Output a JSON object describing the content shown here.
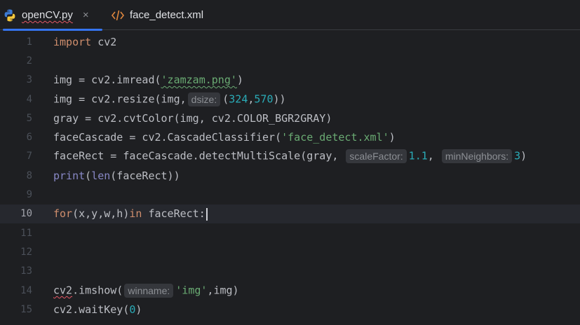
{
  "tabs": [
    {
      "label": "openCV.py",
      "active": true,
      "icon": "python-icon",
      "close": "×"
    },
    {
      "label": "face_detect.xml",
      "active": false,
      "icon": "xml-icon"
    }
  ],
  "hints": {
    "dsize": "dsize:",
    "scaleFactor": "scaleFactor:",
    "minNeighbors": "minNeighbors:",
    "winname": "winname:"
  },
  "lines": [
    {
      "n": "1",
      "tokens": [
        "import",
        " cv2"
      ]
    },
    {
      "n": "2"
    },
    {
      "n": "3",
      "tokens": [
        "img = cv2.imread(",
        "'zamzam.png'",
        ")"
      ]
    },
    {
      "n": "4",
      "tokens": [
        "img = cv2.resize(img,",
        "(",
        "324",
        ",",
        "570",
        "))"
      ]
    },
    {
      "n": "5",
      "tokens": [
        "gray = cv2.cvtColor(img, cv2.COLOR_BGR2GRAY)"
      ]
    },
    {
      "n": "6",
      "tokens": [
        "faceCascade = cv2.CascadeClassifier(",
        "'face_detect.xml'",
        ")"
      ]
    },
    {
      "n": "7",
      "tokens": [
        "faceRect = faceCascade.detectMultiScale(gray, ",
        "1.1",
        ", ",
        "3",
        ")"
      ]
    },
    {
      "n": "8",
      "tokens": [
        "print",
        "(",
        "len",
        "(faceRect))"
      ]
    },
    {
      "n": "9"
    },
    {
      "n": "10",
      "tokens": [
        "for",
        "(x,y,w,h)",
        "in",
        " faceRect:"
      ]
    },
    {
      "n": "11"
    },
    {
      "n": "12"
    },
    {
      "n": "13"
    },
    {
      "n": "14",
      "tokens": [
        "cv2",
        ".imshow(",
        "'img'",
        ",img)"
      ]
    },
    {
      "n": "15",
      "tokens": [
        "cv2.waitKey(",
        "0",
        ")"
      ]
    }
  ],
  "colors": {
    "background": "#1e1f22",
    "accent": "#3574f0",
    "keyword": "#cf8e6d",
    "string": "#6aab73",
    "number": "#2aacb8",
    "builtin": "#8888c6"
  }
}
